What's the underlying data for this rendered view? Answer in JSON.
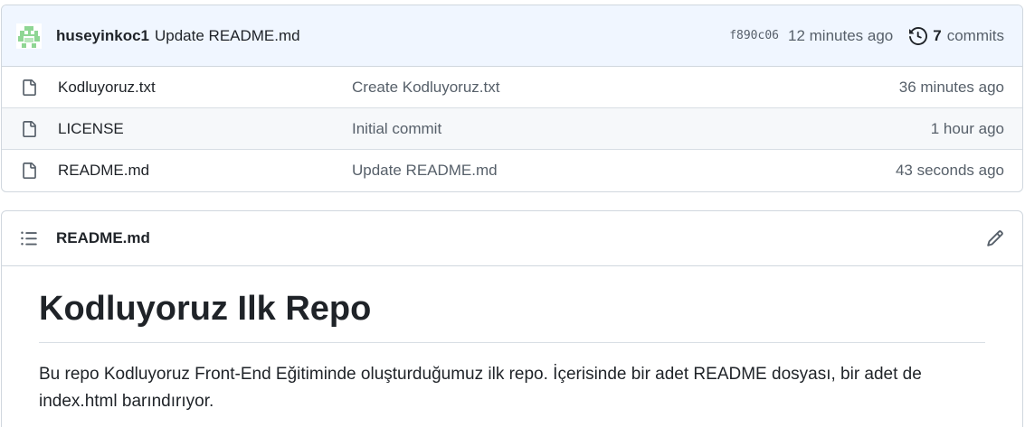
{
  "latest_commit": {
    "author": "huseyinkoc1",
    "message": "Update README.md",
    "sha": "f890c06",
    "time": "12 minutes ago",
    "commits_count": "7",
    "commits_label": "commits"
  },
  "files": [
    {
      "name": "Kodluyoruz.txt",
      "message": "Create Kodluyoruz.txt",
      "age": "36 minutes ago"
    },
    {
      "name": "LICENSE",
      "message": "Initial commit",
      "age": "1 hour ago"
    },
    {
      "name": "README.md",
      "message": "Update README.md",
      "age": "43 seconds ago"
    }
  ],
  "readme": {
    "filename": "README.md",
    "heading": "Kodluyoruz Ilk Repo",
    "paragraph": "Bu repo Kodluyoruz Front-End Eğitiminde oluşturduğumuz ilk repo. İçerisinde bir adet README dosyası, bir adet de index.html barındırıyor."
  },
  "colors": {
    "commit_bar_bg": "#f0f6ff",
    "avatar_green": "#8fd694",
    "muted_text": "#57606a"
  },
  "icons": [
    "avatar",
    "file-icon",
    "history-icon",
    "list-unordered-icon",
    "pencil-icon"
  ]
}
